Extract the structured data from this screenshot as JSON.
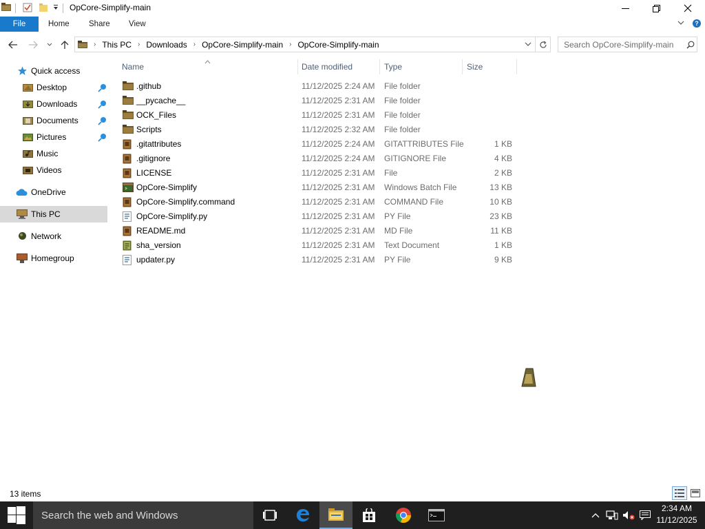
{
  "window": {
    "title": "OpCore-Simplify-main",
    "controls": {
      "minimize": "—",
      "maximize": "❐",
      "close": "✕"
    }
  },
  "ribbon": {
    "tabs": [
      {
        "label": "File"
      },
      {
        "label": "Home"
      },
      {
        "label": "Share"
      },
      {
        "label": "View"
      }
    ]
  },
  "address": {
    "breadcrumbs": [
      "This PC",
      "Downloads",
      "OpCore-Simplify-main",
      "OpCore-Simplify-main"
    ]
  },
  "search": {
    "placeholder": "Search OpCore-Simplify-main"
  },
  "nav_pane": {
    "items": [
      {
        "label": "Quick access",
        "icon": "star-icon",
        "pinned": false
      },
      {
        "label": "Desktop",
        "icon": "folder-icon",
        "pinned": true
      },
      {
        "label": "Downloads",
        "icon": "folder-icon",
        "pinned": true
      },
      {
        "label": "Documents",
        "icon": "folder-icon",
        "pinned": true
      },
      {
        "label": "Pictures",
        "icon": "folder-icon",
        "pinned": true
      },
      {
        "label": "Music",
        "icon": "folder-icon",
        "pinned": false
      },
      {
        "label": "Videos",
        "icon": "folder-icon",
        "pinned": false
      },
      {
        "label": "OneDrive",
        "icon": "cloud-icon",
        "pinned": false
      },
      {
        "label": "This PC",
        "icon": "computer-icon",
        "pinned": false,
        "selected": true
      },
      {
        "label": "Network",
        "icon": "network-icon",
        "pinned": false
      },
      {
        "label": "Homegroup",
        "icon": "homegroup-icon",
        "pinned": false
      }
    ]
  },
  "columns": {
    "name": "Name",
    "date": "Date modified",
    "type": "Type",
    "size": "Size"
  },
  "files": [
    {
      "name": ".github",
      "date": "11/12/2025 2:24 AM",
      "type": "File folder",
      "size": "",
      "icon": "folder-icon"
    },
    {
      "name": "__pycache__",
      "date": "11/12/2025 2:31 AM",
      "type": "File folder",
      "size": "",
      "icon": "folder-icon"
    },
    {
      "name": "OCK_Files",
      "date": "11/12/2025 2:31 AM",
      "type": "File folder",
      "size": "",
      "icon": "folder-icon"
    },
    {
      "name": "Scripts",
      "date": "11/12/2025 2:32 AM",
      "type": "File folder",
      "size": "",
      "icon": "folder-icon"
    },
    {
      "name": ".gitattributes",
      "date": "11/12/2025 2:24 AM",
      "type": "GITATTRIBUTES File",
      "size": "1 KB",
      "icon": "file-icon"
    },
    {
      "name": ".gitignore",
      "date": "11/12/2025 2:24 AM",
      "type": "GITIGNORE File",
      "size": "4 KB",
      "icon": "file-icon"
    },
    {
      "name": "LICENSE",
      "date": "11/12/2025 2:31 AM",
      "type": "File",
      "size": "2 KB",
      "icon": "file-icon"
    },
    {
      "name": "OpCore-Simplify",
      "date": "11/12/2025 2:31 AM",
      "type": "Windows Batch File",
      "size": "13 KB",
      "icon": "batch-file-icon"
    },
    {
      "name": "OpCore-Simplify.command",
      "date": "11/12/2025 2:31 AM",
      "type": "COMMAND File",
      "size": "10 KB",
      "icon": "file-icon"
    },
    {
      "name": "OpCore-Simplify.py",
      "date": "11/12/2025 2:31 AM",
      "type": "PY File",
      "size": "23 KB",
      "icon": "python-file-icon"
    },
    {
      "name": "README.md",
      "date": "11/12/2025 2:31 AM",
      "type": "MD File",
      "size": "11 KB",
      "icon": "file-icon"
    },
    {
      "name": "sha_version",
      "date": "11/12/2025 2:31 AM",
      "type": "Text Document",
      "size": "1 KB",
      "icon": "text-file-icon"
    },
    {
      "name": "updater.py",
      "date": "11/12/2025 2:31 AM",
      "type": "PY File",
      "size": "9 KB",
      "icon": "python-file-icon"
    }
  ],
  "status": {
    "item_count": "13 items"
  },
  "taskbar": {
    "search_text": "Search the web and Windows",
    "apps": [
      "task-view-icon",
      "edge-icon",
      "file-explorer-icon",
      "store-icon",
      "chrome-icon",
      "cmd-icon"
    ],
    "clock_time": "2:34 AM",
    "clock_date": "11/12/2025"
  },
  "colors": {
    "accent": "#1979ca",
    "taskbar": "#1f1f1f",
    "folder": "#8a6d2f",
    "selected_bg": "#d9d9d9",
    "header_text": "#4c607a"
  }
}
